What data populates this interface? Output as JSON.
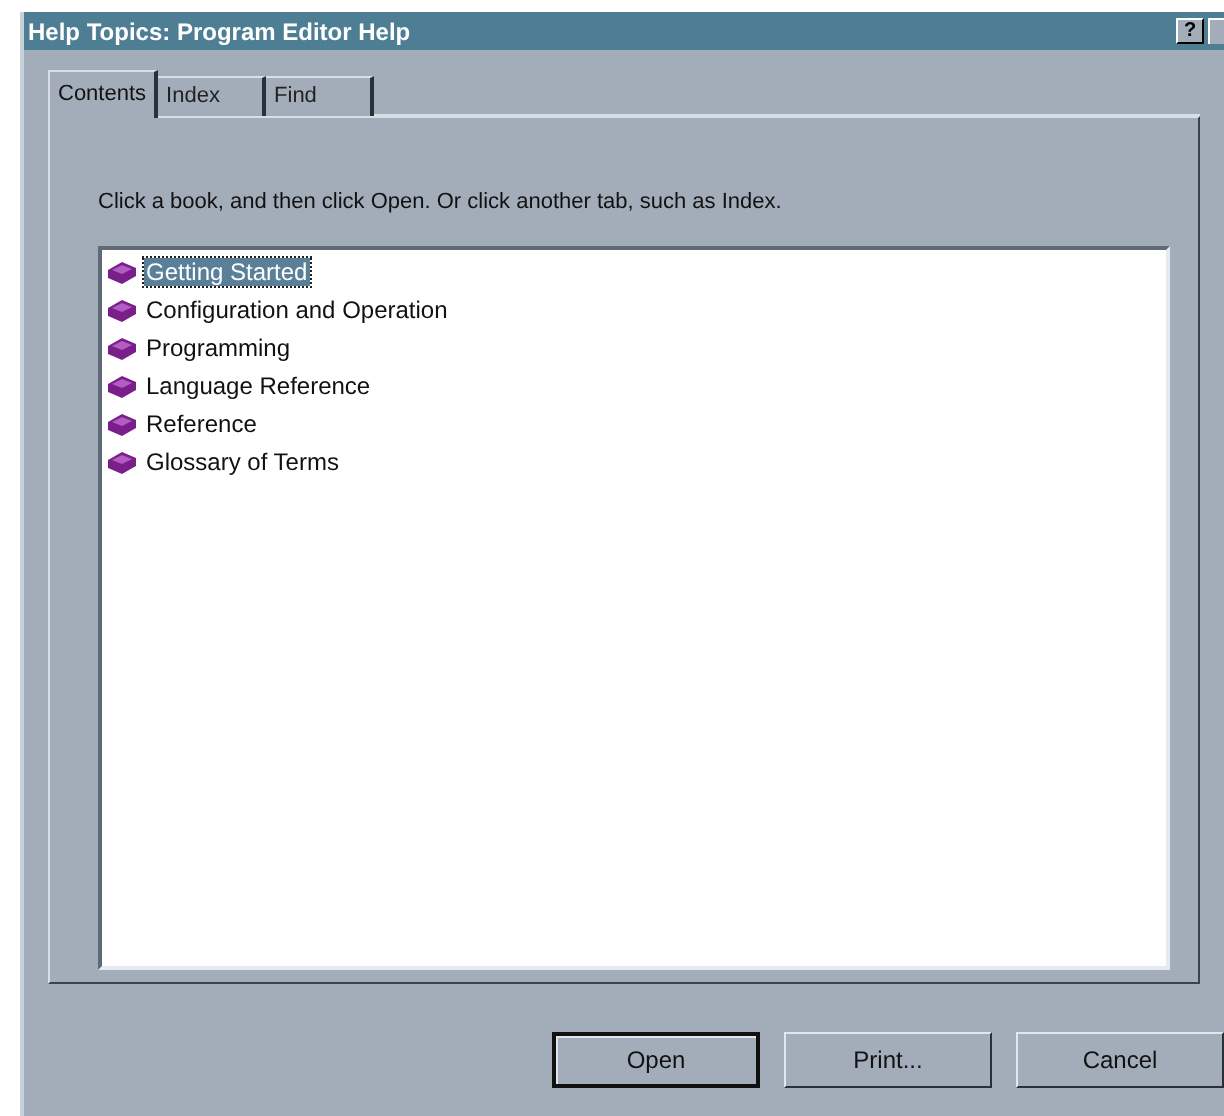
{
  "window": {
    "title": "Help Topics: Program Editor Help",
    "help_button": "?"
  },
  "tabs": [
    {
      "label": "Contents",
      "selected": true
    },
    {
      "label": "Index",
      "selected": false
    },
    {
      "label": "Find",
      "selected": false
    }
  ],
  "instruction": "Click a book, and then click Open. Or click another tab, such as Index.",
  "topics": [
    {
      "label": "Getting Started",
      "selected": true
    },
    {
      "label": "Configuration and Operation",
      "selected": false
    },
    {
      "label": "Programming",
      "selected": false
    },
    {
      "label": "Language Reference",
      "selected": false
    },
    {
      "label": "Reference",
      "selected": false
    },
    {
      "label": "Glossary of Terms",
      "selected": false
    }
  ],
  "buttons": [
    {
      "label": "Open",
      "default": true
    },
    {
      "label": "Print...",
      "default": false
    },
    {
      "label": "Cancel",
      "default": false
    }
  ]
}
